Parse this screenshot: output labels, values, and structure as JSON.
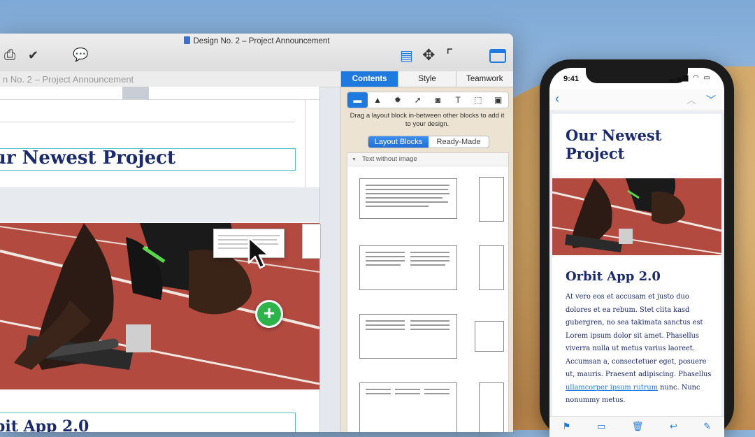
{
  "window": {
    "title": "Design No. 2 – Project Announcement",
    "canvas_tab": "n No. 2 – Project Announcement"
  },
  "canvas": {
    "heading1": "ur Newest Project",
    "heading2": "bit App 2.0"
  },
  "sidebar": {
    "tabs": [
      "Contents",
      "Style",
      "Teamwork"
    ],
    "hint": "Drag a layout block in-between other blocks to add it to your design.",
    "segments": [
      "Layout Blocks",
      "Ready-Made"
    ],
    "section": "Text without image",
    "tool_icons": [
      "layout-block-icon",
      "shape-icon",
      "badge-icon",
      "rocket-icon",
      "photo-icon",
      "text-icon",
      "selection-icon",
      "image-icon"
    ]
  },
  "phone": {
    "time": "9:41",
    "heading1": "Our Newest Project",
    "heading2": "Orbit App 2.0",
    "body_before_link": "At vero eos et accusam et justo duo dolores et ea rebum. Stet clita kasd gubergren, no sea takimata sanctus est Lorem ipsum dolor sit amet. Phasellus viverra nulla ut metus varius laoreet. Accumsan a, consectetuer eget, posuere ut, mauris. Praesent adipiscing. Phasellus ",
    "body_link": "ullamcorper ipsum rutrum",
    "body_after_link": " nunc. Nunc nonummy metus."
  },
  "colors": {
    "accent": "#1f7ae0",
    "heading": "#1a2a6b",
    "add": "#2db34a"
  }
}
